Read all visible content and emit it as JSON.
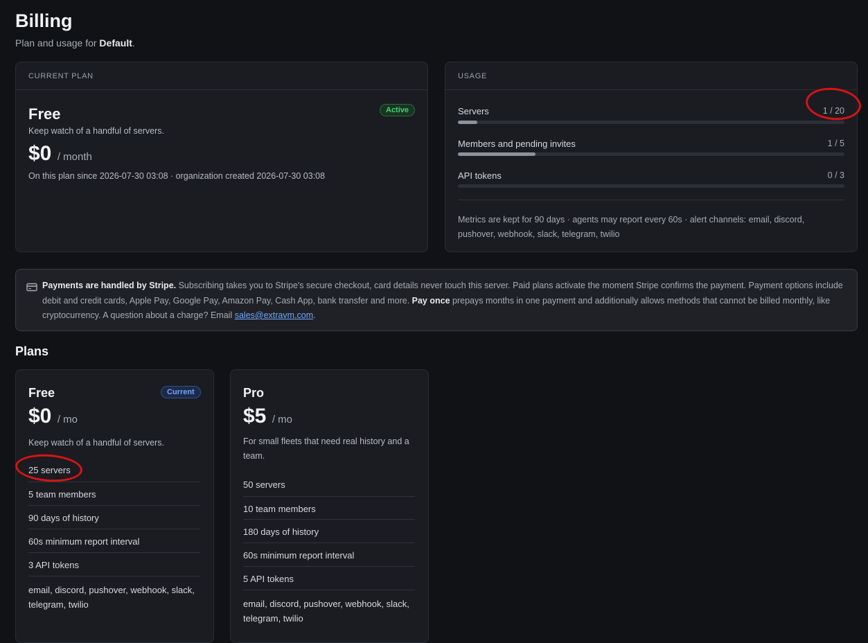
{
  "header": {
    "title": "Billing",
    "subtitle_prefix": "Plan and usage for ",
    "org_name": "Default",
    "subtitle_suffix": "."
  },
  "current_plan": {
    "section_label": "CURRENT PLAN",
    "name": "Free",
    "status_badge": "Active",
    "description": "Keep watch of a handful of servers.",
    "price": "$0",
    "period": "/ month",
    "since_text": "On this plan since 2026-07-30 03:08 · organization created 2026-07-30 03:08"
  },
  "usage": {
    "section_label": "USAGE",
    "items": [
      {
        "label": "Servers",
        "value": "1 / 20",
        "fraction": 0.05
      },
      {
        "label": "Members and pending invites",
        "value": "1 / 5",
        "fraction": 0.2
      },
      {
        "label": "API tokens",
        "value": "0 / 3",
        "fraction": 0.0
      }
    ],
    "note": "Metrics are kept for 90 days · agents may report every 60s · alert channels: email, discord, pushover, webhook, slack, telegram, twilio"
  },
  "payment_notice": {
    "icon": "credit-card-icon",
    "bold_lead": "Payments are handled by Stripe.",
    "text_1": " Subscribing takes you to Stripe's secure checkout, card details never touch this server. Paid plans activate the moment Stripe confirms the payment. Payment options include debit and credit cards, Apple Pay, Google Pay, Amazon Pay, Cash App, bank transfer and more. ",
    "bold_pay_once": "Pay once",
    "text_2": " prepays months in one payment and additionally allows methods that cannot be billed monthly, like cryptocurrency. A question about a charge? Email ",
    "email": "sales@extravm.com",
    "text_3": "."
  },
  "plans": {
    "heading": "Plans",
    "list": [
      {
        "name": "Free",
        "badge": "Current",
        "price": "$0",
        "period": "/ mo",
        "description": "Keep watch of a handful of servers.",
        "features": [
          "25 servers",
          "5 team members",
          "90 days of history",
          "60s minimum report interval",
          "3 API tokens",
          "email, discord, pushover, webhook, slack, telegram, twilio"
        ]
      },
      {
        "name": "Pro",
        "price": "$5",
        "period": "/ mo",
        "description": "For small fleets that need real history and a team.",
        "features": [
          "50 servers",
          "10 team members",
          "180 days of history",
          "60s minimum report interval",
          "5 API tokens",
          "email, discord, pushover, webhook, slack, telegram, twilio"
        ]
      }
    ]
  },
  "colors": {
    "background": "#111216",
    "card": "#1a1c21",
    "active_green": "#4ccf7a",
    "current_blue": "#7aa3f0",
    "link": "#6ea8ff",
    "annotation_red": "#d81414"
  }
}
